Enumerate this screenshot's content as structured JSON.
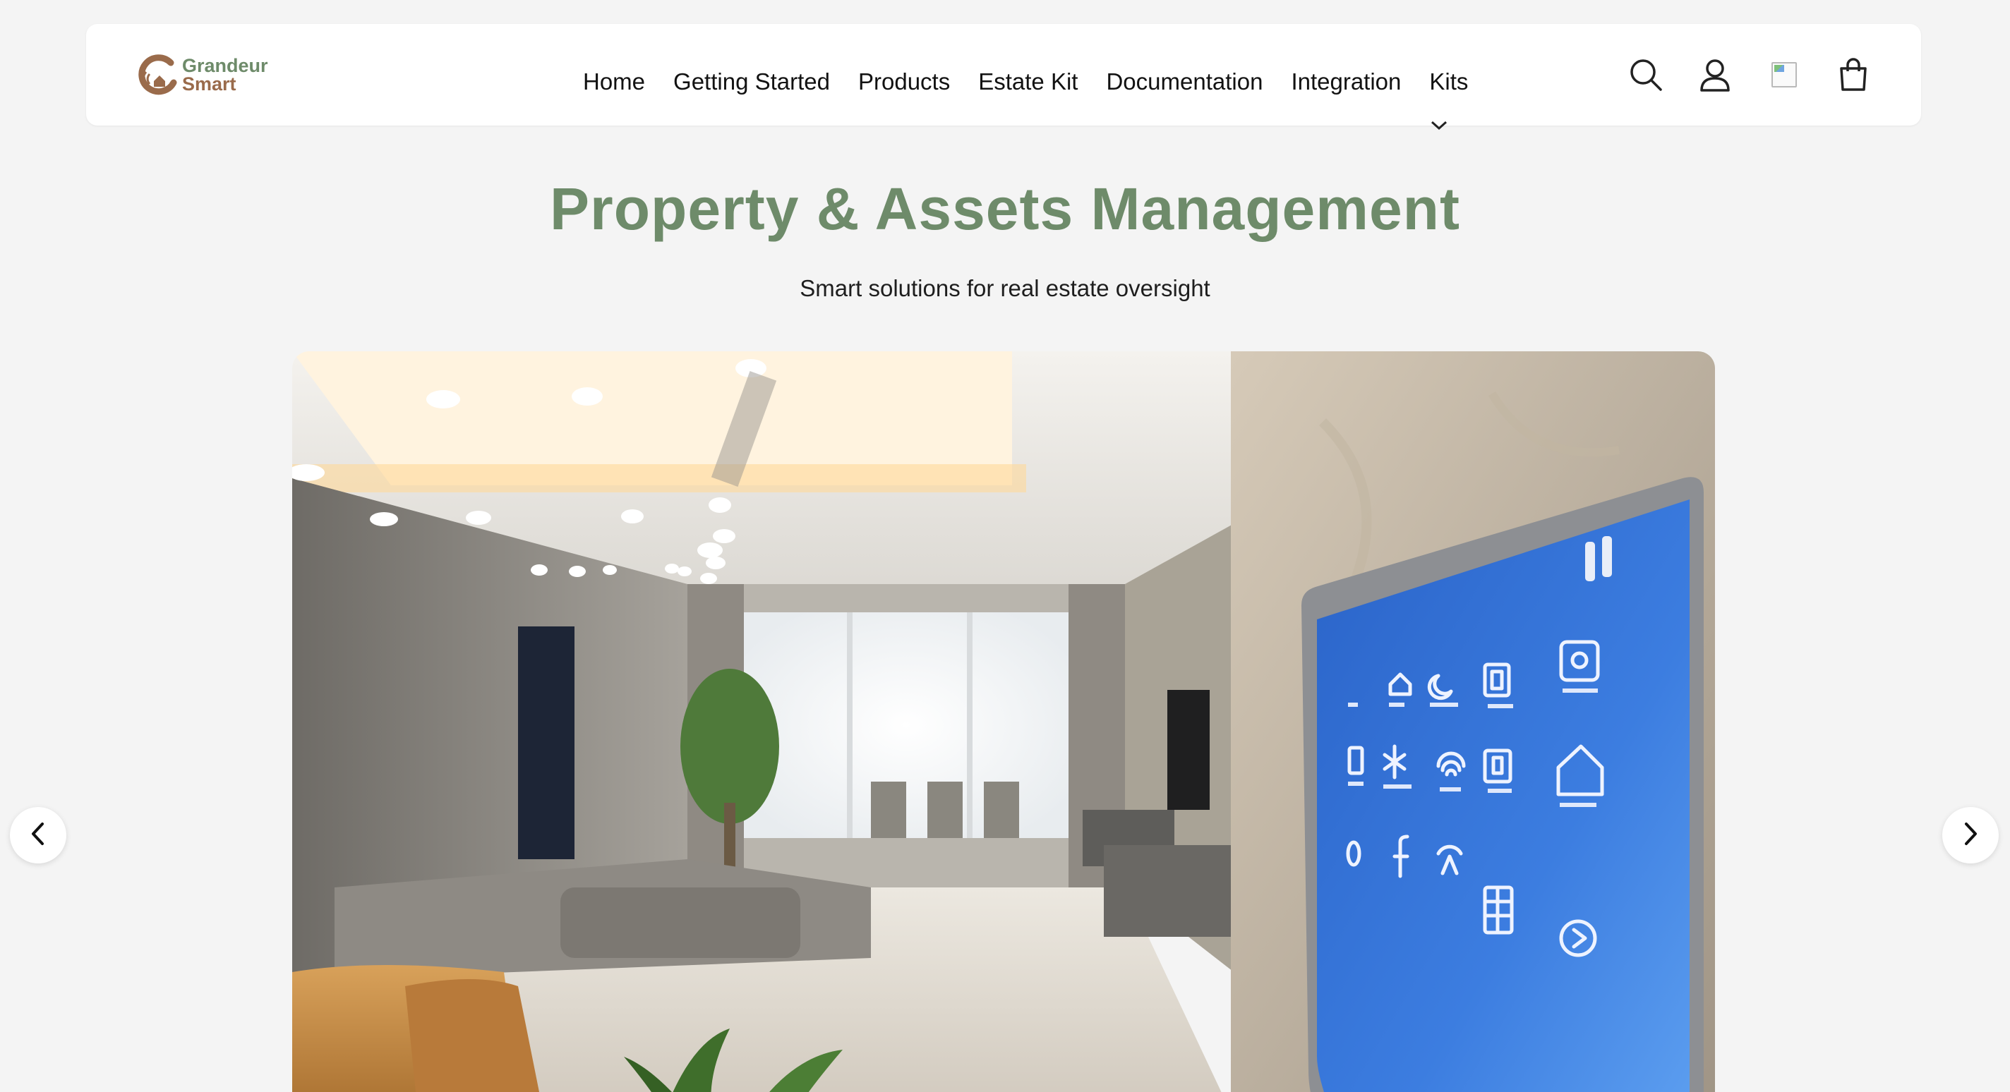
{
  "brand": {
    "line1": "Grandeur",
    "line2": "Smart"
  },
  "nav": [
    {
      "label": "Home"
    },
    {
      "label": "Getting Started"
    },
    {
      "label": "Products"
    },
    {
      "label": "Estate Kit"
    },
    {
      "label": "Documentation"
    },
    {
      "label": "Integration"
    },
    {
      "label": "Kits"
    }
  ],
  "header_icons": [
    "search-icon",
    "account-icon",
    "language-flag-image",
    "cart-bag-icon"
  ],
  "hero": {
    "title": "Property & Assets Management",
    "subtitle": "Smart solutions for real estate oversight"
  },
  "slider": {
    "prev_icon": "chevron-left-icon",
    "next_icon": "chevron-right-icon",
    "panel_icons": [
      "home-icon",
      "moon-icon",
      "square-icon",
      "camera-icon",
      "phone-icon",
      "fan-icon",
      "wifi-icon",
      "lock-icon",
      "shield-icon",
      "power-icon",
      "facebook-icon",
      "signal-icon",
      "grid-icon",
      "play-icon",
      "pause-icon"
    ]
  },
  "colors": {
    "brand_green": "#6e8b6a",
    "brand_brown": "#9a6b4b",
    "page_bg": "#f4f4f4",
    "panel_blue": "#2f6fd6"
  }
}
